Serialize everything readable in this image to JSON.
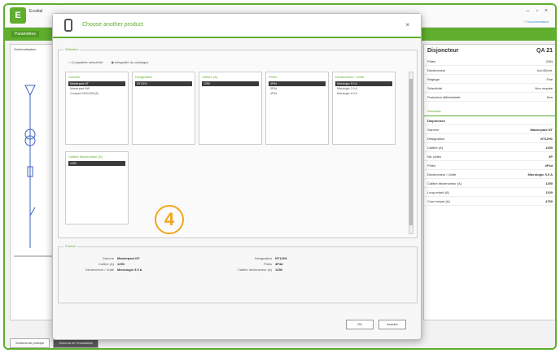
{
  "app": {
    "title": "Ecodial",
    "subtitle": "",
    "help": "? Documentation",
    "ribbon_tab": "Paramètres"
  },
  "left": {
    "label": "Schématisation"
  },
  "right": {
    "header": "Disjoncteur",
    "ref": "QA 21",
    "props": [
      [
        "Pôles",
        "3/3N"
      ],
      [
        "Déclencheur",
        "Ind./Electr."
      ],
      [
        "Réglage",
        "Fixe"
      ],
      [
        "Sélectivité",
        "Non requise"
      ],
      [
        "Protection différentielle",
        "Non"
      ]
    ],
    "section": "Résultats",
    "sub": "Disjoncteur",
    "results": [
      [
        "Gamme",
        "Masterpact NT"
      ],
      [
        "Désignation",
        "NT12H1"
      ],
      [
        "Calibre (A)",
        "1250"
      ],
      [
        "Nb. pôles",
        "4P"
      ],
      [
        "Pôles",
        "4P4d"
      ],
      [
        "Déclencheur / Unité",
        "Micrologic 5.0 A"
      ],
      [
        "Calibre déclencheur (A)",
        "1250"
      ],
      [
        "Long retard (A)",
        "1100"
      ],
      [
        "Court retard (A)",
        "4750"
      ]
    ]
  },
  "status": {
    "tabs": [
      "Schéma de principe",
      "Schéma de l'installation"
    ]
  },
  "modal": {
    "title": "Choose another product",
    "selection_legend": "Sélection",
    "radio1": "Compatible sélectivité",
    "radio2": "Intégralité du catalogue",
    "columns": [
      {
        "head": "Gamme",
        "items": [
          "Masterpact NT",
          "Masterpact NW",
          "Compact NSX/NSX(A)"
        ],
        "sel": 0
      },
      {
        "head": "Désignation",
        "items": [
          "NT12H1"
        ],
        "sel": 0
      },
      {
        "head": "Calibre (A)",
        "items": [
          "1250"
        ],
        "sel": 0
      },
      {
        "head": "Pôles",
        "items": [
          "4P4d",
          "3P3d",
          "4P3d"
        ],
        "sel": 0
      },
      {
        "head": "Déclencheur / Unité",
        "items": [
          "Micrologic 5.0 A",
          "Micrologic 2.0 A",
          "Micrologic 6.0 A"
        ],
        "sel": 0
      }
    ],
    "column2": {
      "head": "Calibre déclencheur (A)",
      "items": [
        "1250"
      ]
    },
    "badge": "4",
    "product_legend": "Produit",
    "product_left": [
      [
        "Gamme",
        "Masterpact NT"
      ],
      [
        "Calibre (A)",
        "1250"
      ],
      [
        "Déclencheur / Unité",
        "Micrologic 5.0 A"
      ]
    ],
    "product_right": [
      [
        "Désignation",
        "NT12H1"
      ],
      [
        "Pôles",
        "4P4d"
      ],
      [
        "Calibre déclencheur (A)",
        "1250"
      ]
    ],
    "ok": "OK",
    "cancel": "Annuler"
  }
}
